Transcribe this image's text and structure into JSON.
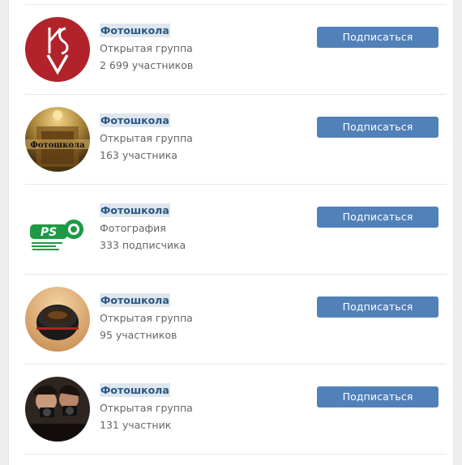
{
  "groups": [
    {
      "name": "Фотошкола",
      "type": "Открытая группа",
      "members": "2 699 участников",
      "button": "Подписаться",
      "avatar": "ksv-logo",
      "color": "#b1222a"
    },
    {
      "name": "Фотошкола",
      "type": "Открытая группа",
      "members": "163 участника",
      "button": "Подписаться",
      "avatar": "doorway-photo",
      "avatar_text": "Фотошкола",
      "color": "#8a6a2a"
    },
    {
      "name": "Фотошкола",
      "type": "Фотография",
      "members": "333 подписчика",
      "button": "Подписаться",
      "avatar": "ps-school-logo",
      "avatar_text": "PS",
      "color": "#1e9a46"
    },
    {
      "name": "Фотошкола",
      "type": "Открытая группа",
      "members": "95 участников",
      "button": "Подписаться",
      "avatar": "camera-lens-photo",
      "color": "#d9a66e"
    },
    {
      "name": "Фотошкола",
      "type": "Открытая группа",
      "members": "131 участник",
      "button": "Подписаться",
      "avatar": "photographers-photo",
      "color": "#3a2b24"
    }
  ],
  "colors": {
    "link": "#2a5885",
    "button_bg": "#5181b8",
    "meta_text": "#656565",
    "page_bg": "#edeef0"
  }
}
